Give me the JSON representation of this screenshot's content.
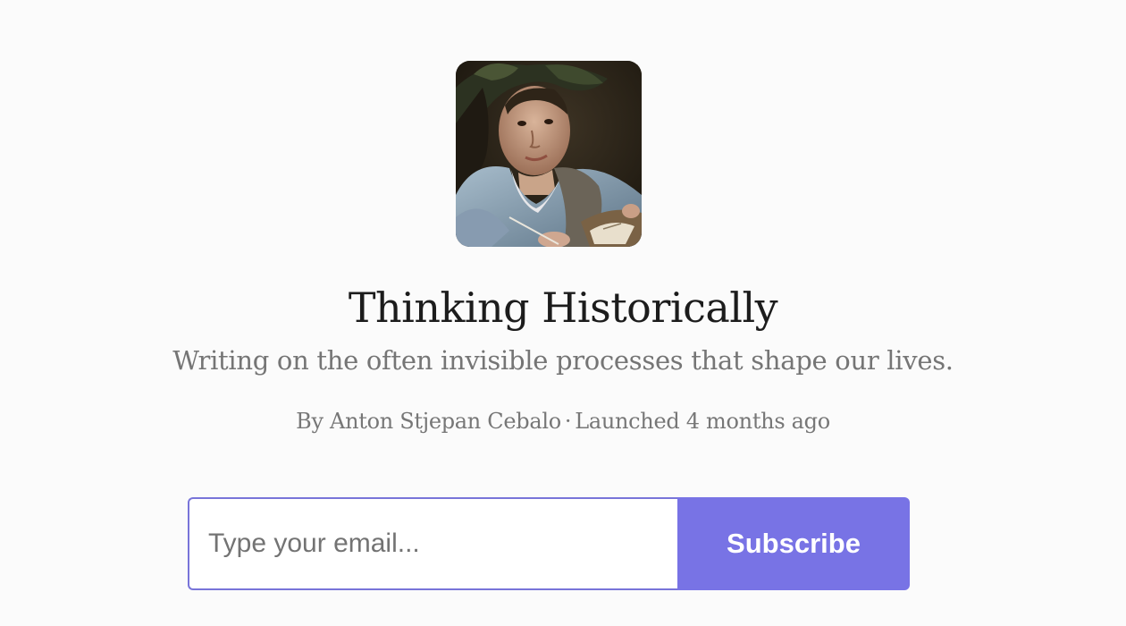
{
  "publication": {
    "title": "Thinking Historically",
    "subtitle": "Writing on the often invisible processes that shape our lives.",
    "author_line": "By Anton Stjepan Cebalo",
    "separator": "·",
    "launched": "Launched 4 months ago",
    "logo": "portrait-painting-logo"
  },
  "subscribe": {
    "email_placeholder": "Type your email...",
    "email_value": "",
    "button_label": "Subscribe",
    "accent_color": "#7873e5"
  }
}
